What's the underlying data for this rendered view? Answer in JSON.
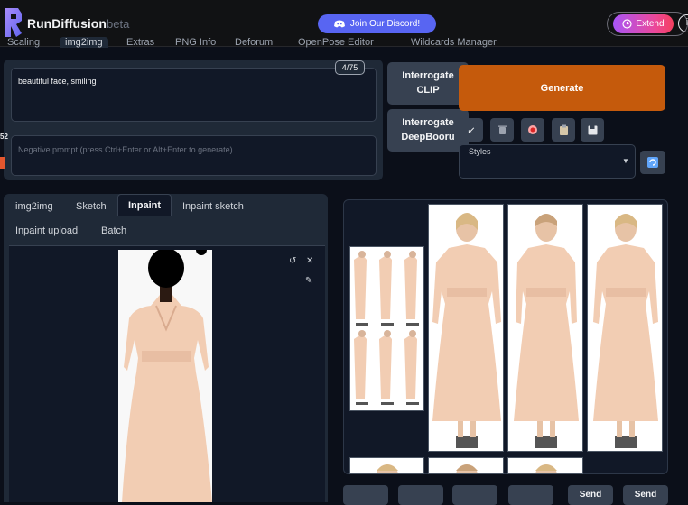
{
  "header": {
    "brand": "RunDiffusion",
    "beta": "beta",
    "discord_label": "Join Our Discord!",
    "extend_label": "Extend",
    "info_label": "i"
  },
  "top_tabs": [
    "Scaling",
    "img2img",
    "Extras",
    "PNG Info",
    "Deforum",
    "OpenPose Editor",
    "Wildcards Manager"
  ],
  "prompt": {
    "value": "beautiful face, smiling",
    "counter": "4/75",
    "negative_placeholder": "Negative prompt (press Ctrl+Enter or Alt+Enter to generate)"
  },
  "side_number": "52",
  "buttons": {
    "interrogate_clip": [
      "Interrogate",
      "CLIP"
    ],
    "interrogate_deepbooru": [
      "Interrogate",
      "DeepBooru"
    ],
    "generate": "Generate"
  },
  "styles": {
    "label": "Styles"
  },
  "subtabs": {
    "row1": [
      "img2img",
      "Sketch",
      "Inpaint",
      "Inpaint sketch"
    ],
    "row2": [
      "Inpaint upload",
      "Batch"
    ],
    "active": "Inpaint"
  },
  "bottom_buttons": [
    "",
    "",
    "",
    "",
    "Send",
    "Send"
  ],
  "colors": {
    "generate": "#c55a0c",
    "discord": "#5865f2",
    "dress": "#f2cdb3",
    "background": "#0b0f19"
  }
}
